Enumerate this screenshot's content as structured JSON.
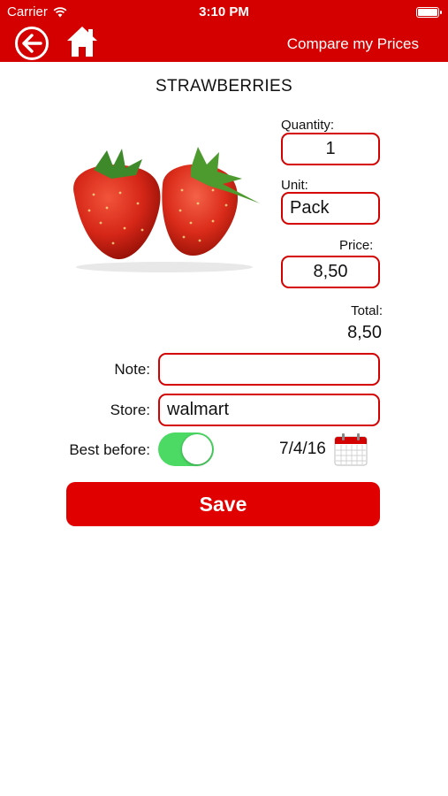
{
  "status_bar": {
    "carrier": "Carrier",
    "time": "3:10 PM"
  },
  "header": {
    "back_icon": "arrow-left-circle-icon",
    "home_icon": "home-icon",
    "compare_label": "Compare my Prices"
  },
  "product": {
    "name": "STRAWBERRIES",
    "image": "strawberries-image"
  },
  "quantity": {
    "label": "Quantity:",
    "value": "1"
  },
  "unit": {
    "label": "Unit:",
    "value": "Pack"
  },
  "price": {
    "label": "Price:",
    "value": "8,50"
  },
  "total": {
    "label": "Total:",
    "value": "8,50"
  },
  "note": {
    "label": "Note:",
    "value": ""
  },
  "store": {
    "label": "Store:",
    "value": "walmart"
  },
  "best_before": {
    "label": "Best before:",
    "enabled": true,
    "date": "7/4/16",
    "calendar_icon": "calendar-icon"
  },
  "save": {
    "label": "Save"
  },
  "colors": {
    "brand_red": "#d40000",
    "toggle_green": "#4cd964"
  }
}
